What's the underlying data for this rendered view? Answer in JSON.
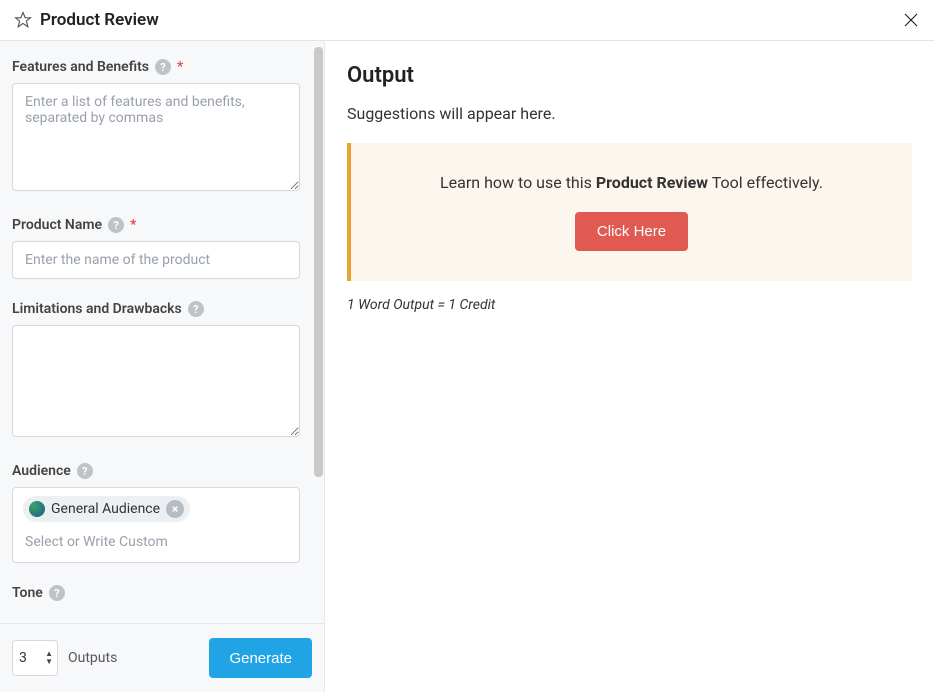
{
  "header": {
    "title": "Product Review"
  },
  "form": {
    "features": {
      "label": "Features and Benefits",
      "placeholder": "Enter a list of features and benefits, separated by commas",
      "required": true
    },
    "product_name": {
      "label": "Product Name",
      "placeholder": "Enter the name of the product",
      "required": true
    },
    "limitations": {
      "label": "Limitations and Drawbacks"
    },
    "audience": {
      "label": "Audience",
      "chip": "General Audience",
      "placeholder": "Select or Write Custom"
    },
    "tone": {
      "label": "Tone"
    },
    "outputs": {
      "value": "3",
      "label": "Outputs"
    },
    "generate": "Generate"
  },
  "output": {
    "title": "Output",
    "subtitle": "Suggestions will appear here.",
    "tip_before": "Learn how to use this ",
    "tip_bold": "Product Review",
    "tip_after": " Tool effectively.",
    "click_here": "Click Here",
    "credit": "1 Word Output = 1 Credit"
  }
}
